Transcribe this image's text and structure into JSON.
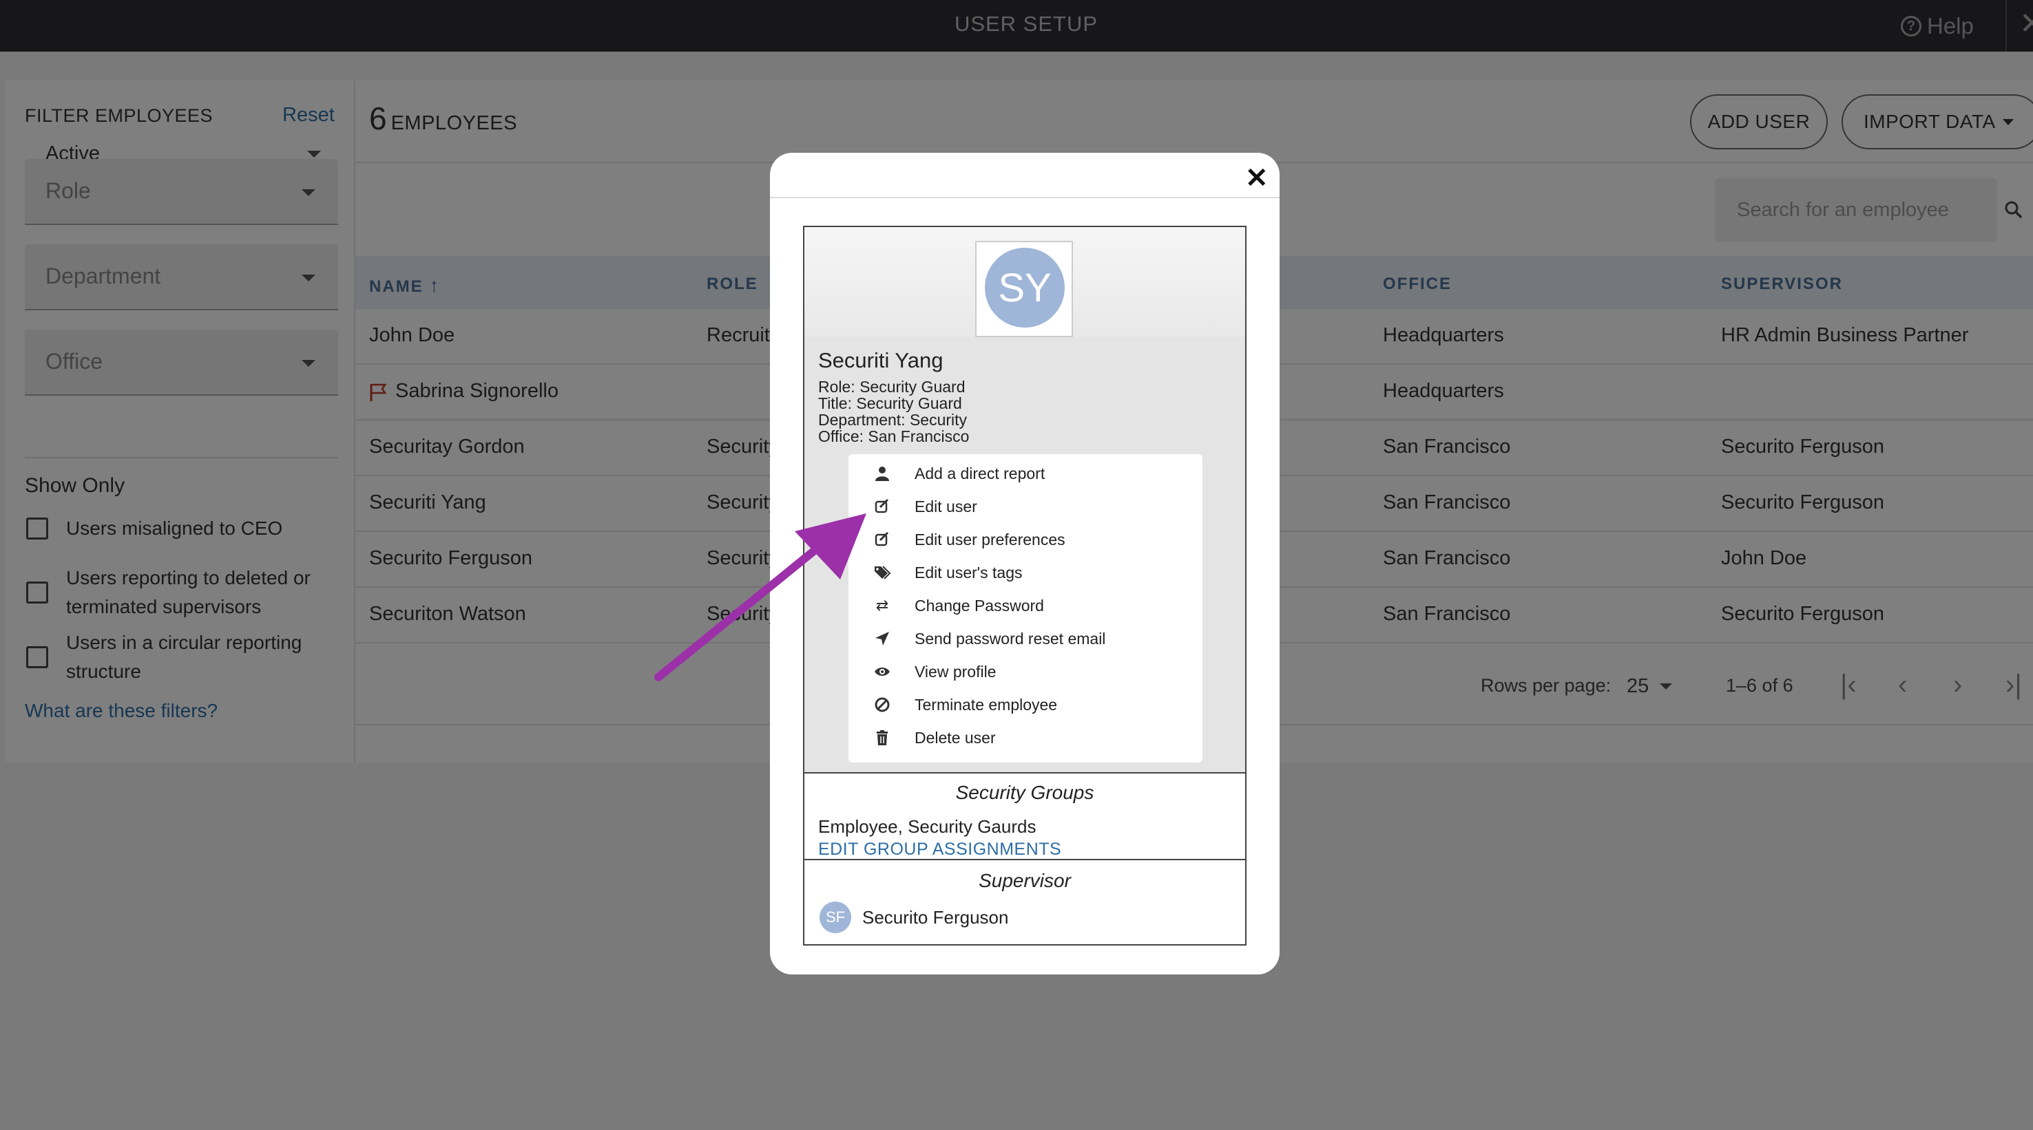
{
  "topbar": {
    "title": "USER SETUP",
    "help_label": "Help",
    "help_icon": "question-circle-icon",
    "close_icon": "close-icon"
  },
  "filters": {
    "heading": "FILTER EMPLOYEES",
    "reset_label": "Reset",
    "status_value": "Active",
    "role_placeholder": "Role",
    "department_placeholder": "Department",
    "office_placeholder": "Office",
    "show_only_heading": "Show Only",
    "options": [
      "Users misaligned to CEO",
      "Users reporting to deleted or terminated supervisors",
      "Users in a circular reporting structure"
    ],
    "what_link": "What are these filters?"
  },
  "main": {
    "count": "6",
    "count_label": "EMPLOYEES",
    "add_user": "ADD USER",
    "import_data": "IMPORT DATA",
    "search_placeholder": "Search for an employee",
    "columns": {
      "name": "NAME",
      "role": "ROLE",
      "office": "OFFICE",
      "supervisor": "SUPERVISOR"
    },
    "rows": [
      {
        "name": "John Doe",
        "role": "Recruite",
        "office": "Headquarters",
        "supervisor": "HR Admin Business Partner",
        "flagged": false
      },
      {
        "name": "Sabrina Signorello",
        "role": "",
        "office": "Headquarters",
        "supervisor": "",
        "flagged": true
      },
      {
        "name": "Securitay Gordon",
        "role": "Security",
        "office": "San Francisco",
        "supervisor": "Securito Ferguson",
        "flagged": false
      },
      {
        "name": "Securiti Yang",
        "role": "Security",
        "office": "San Francisco",
        "supervisor": "Securito Ferguson",
        "flagged": false
      },
      {
        "name": "Securito Ferguson",
        "role": "Security",
        "office": "San Francisco",
        "supervisor": "John Doe",
        "flagged": false
      },
      {
        "name": "Securiton Watson",
        "role": "Security",
        "office": "San Francisco",
        "supervisor": "Securito Ferguson",
        "flagged": false
      }
    ],
    "rows_per_page_label": "Rows per page:",
    "rows_per_page_value": "25",
    "range": "1–6 of 6"
  },
  "modal": {
    "initials": "SY",
    "name": "Securiti Yang",
    "role_line": "Role: Security Guard",
    "title_line": "Title: Security Guard",
    "department_line": "Department: Security",
    "office_line": "Office: San Francisco",
    "menu": [
      {
        "label": "Add a direct report",
        "icon": "person-icon"
      },
      {
        "label": "Edit user",
        "icon": "edit-icon"
      },
      {
        "label": "Edit user preferences",
        "icon": "edit-icon"
      },
      {
        "label": "Edit user's tags",
        "icon": "tags-icon"
      },
      {
        "label": "Change Password",
        "icon": "shuffle-icon"
      },
      {
        "label": "Send password reset email",
        "icon": "send-icon"
      },
      {
        "label": "View profile",
        "icon": "eye-icon"
      },
      {
        "label": "Terminate employee",
        "icon": "ban-icon"
      },
      {
        "label": "Delete user",
        "icon": "trash-icon"
      }
    ],
    "security_groups_heading": "Security Groups",
    "security_groups_value": "Employee, Security Gaurds",
    "edit_groups_link": "EDIT GROUP ASSIGNMENTS",
    "supervisor_heading": "Supervisor",
    "supervisor_initials": "SF",
    "supervisor_name": "Securito Ferguson"
  },
  "annotation": {
    "arrow_color": "#9b30a8"
  }
}
